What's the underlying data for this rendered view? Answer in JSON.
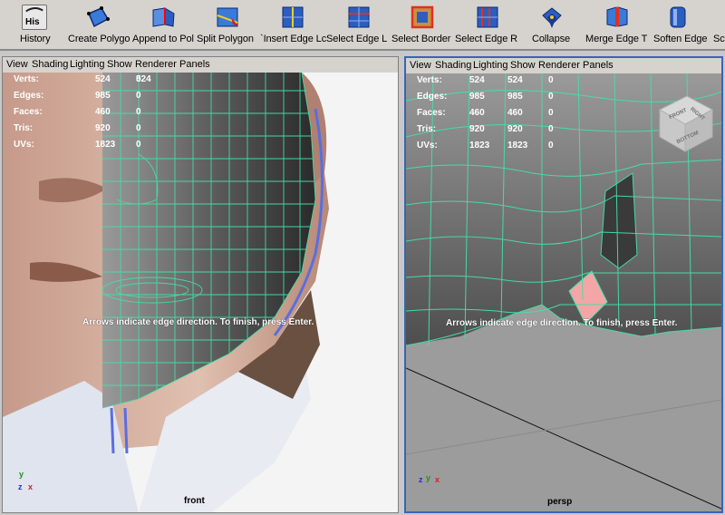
{
  "shelf": {
    "tools": [
      {
        "id": "history",
        "icon": "history-icon",
        "label": "History",
        "icon_text": "His"
      },
      {
        "id": "create-polygon",
        "icon": "create-polygon-icon",
        "label": "Create Polygo"
      },
      {
        "id": "append-polygon",
        "icon": "append-polygon-icon",
        "label": "Append to Pol"
      },
      {
        "id": "split-polygon",
        "icon": "split-polygon-icon",
        "label": "Split Polygon"
      },
      {
        "id": "insert-edge-loop",
        "icon": "insert-edge-loop-icon",
        "label": "`Insert Edge Lc"
      },
      {
        "id": "select-edge-loop",
        "icon": "select-edge-loop-icon",
        "label": "Select Edge L"
      },
      {
        "id": "select-border",
        "icon": "select-border-icon",
        "label": "Select Border"
      },
      {
        "id": "select-edge-ring",
        "icon": "select-edge-ring-icon",
        "label": "Select Edge R"
      },
      {
        "id": "collapse",
        "icon": "collapse-icon",
        "label": "Collapse"
      },
      {
        "id": "merge-edge",
        "icon": "merge-edge-icon",
        "label": "Merge Edge T"
      },
      {
        "id": "soften-edge",
        "icon": "soften-edge-icon",
        "label": "Soften Edge"
      },
      {
        "id": "more",
        "icon": "more-tool-icon",
        "label": "Sc"
      }
    ]
  },
  "panel_menu": [
    "View",
    "Shading",
    "Lighting",
    "Show",
    "Renderer",
    "Panels"
  ],
  "hud": {
    "rows": [
      {
        "label": "Verts:",
        "a": "524",
        "b": "524",
        "c": "0"
      },
      {
        "label": "Edges:",
        "a": "985",
        "b": "985",
        "c": "0"
      },
      {
        "label": "Faces:",
        "a": "460",
        "b": "460",
        "c": "0"
      },
      {
        "label": "Tris:",
        "a": "920",
        "b": "920",
        "c": "0"
      },
      {
        "label": "UVs:",
        "a": "1823",
        "b": "1823",
        "c": "0"
      }
    ]
  },
  "hint": "Arrows indicate edge direction. To finish, press Enter.",
  "viewports": {
    "front": {
      "camera": "front"
    },
    "persp": {
      "camera": "persp"
    }
  },
  "axes": {
    "x": "x",
    "y": "y",
    "z": "z"
  },
  "viewcube": {
    "faces": [
      "FRONT",
      "RIGHT",
      "BOTTOM"
    ]
  },
  "colors": {
    "wireframe": "#44e0a8",
    "selection_face": "#f4a6a6",
    "active_border": "#3a63b8",
    "ui_gray": "#d6d3ce"
  }
}
